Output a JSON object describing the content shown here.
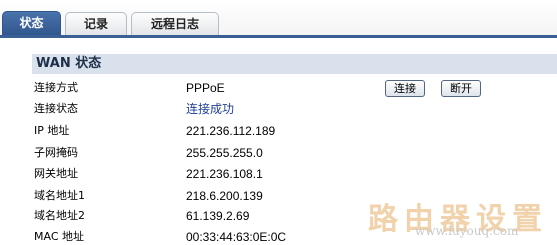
{
  "tabs": [
    {
      "label": "状态",
      "active": true
    },
    {
      "label": "记录",
      "active": false
    },
    {
      "label": "远程日志",
      "active": false
    }
  ],
  "wan": {
    "title": "WAN 状态",
    "rows": [
      {
        "label": "连接方式",
        "value": "PPPoE"
      },
      {
        "label": "连接状态",
        "value": "连接成功"
      },
      {
        "label": "IP 地址",
        "value": "221.236.112.189"
      },
      {
        "label": "子网掩码",
        "value": "255.255.255.0"
      },
      {
        "label": "网关地址",
        "value": "221.236.108.1"
      },
      {
        "label": "域名地址1",
        "value": "218.6.200.139"
      },
      {
        "label": "域名地址2",
        "value": "61.139.2.69"
      },
      {
        "label": "MAC 地址",
        "value": "00:33:44:63:0E:0C"
      }
    ],
    "connect_label": "连接",
    "disconnect_label": "断开"
  },
  "watermark": {
    "text": "路由器设置",
    "url": "www.luyouq.com"
  },
  "colors": {
    "tab_active": "#3a5f95",
    "section_header_bg": "#d8e1ec",
    "status_link": "#1f3f9a"
  }
}
